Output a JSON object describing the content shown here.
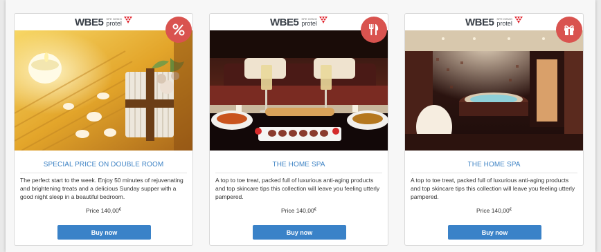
{
  "brand": {
    "logo_main": "WBE5",
    "logo_small": "SPE DEMO",
    "logo_sub": "protel"
  },
  "offers": [
    {
      "title": "SPECIAL PRICE ON DOUBLE ROOM",
      "description": "The perfect start to the week. Enjoy 50 minutes of rejuvenating and brightening treats and a delicious Sunday supper with a good night sleep in a beautiful bedroom.",
      "price_label": "Price",
      "price_value": "140,00",
      "currency": "€",
      "button_label": "Buy now",
      "badge_icon": "percent-icon"
    },
    {
      "title": "THE HOME SPA",
      "description": "A top to toe treat, packed full of luxurious anti-aging products and top skincare tips this collection will leave you feeling utterly pampered.",
      "price_label": "Price",
      "price_value": "140,00",
      "currency": "€",
      "button_label": "Buy now",
      "badge_icon": "fork-knife-icon"
    },
    {
      "title": "THE HOME SPA",
      "description": "A top to toe treat, packed full of luxurious anti-aging products and top skincare tips this collection will leave you feeling utterly pampered.",
      "price_label": "Price",
      "price_value": "140,00",
      "currency": "€",
      "button_label": "Buy now",
      "badge_icon": "gift-icon"
    }
  ],
  "colors": {
    "accent_blue": "#3a82c8",
    "title_blue": "#3d82c4",
    "badge_red": "#d9534f"
  }
}
